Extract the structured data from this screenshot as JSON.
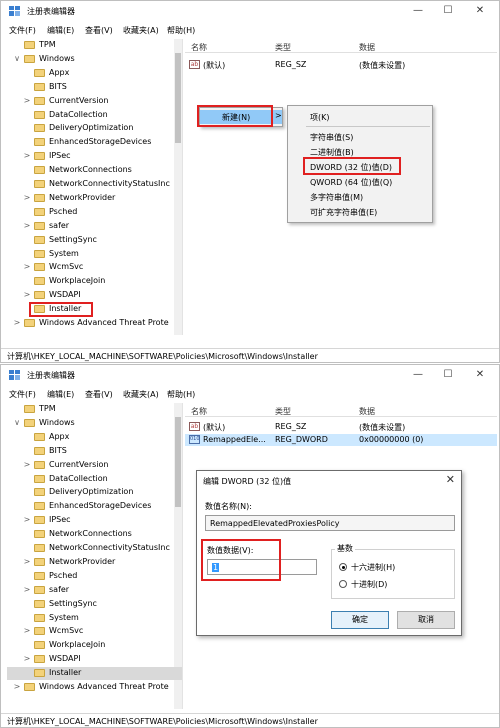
{
  "window_title": "注册表编辑器",
  "window_buttons": {
    "minimize": "—",
    "maximize": "☐",
    "close": "✕"
  },
  "menu": [
    "文件(F)",
    "编辑(E)",
    "查看(V)",
    "收藏夹(A)",
    "帮助(H)"
  ],
  "tree_items": [
    {
      "label": "TPM",
      "expander": ""
    },
    {
      "label": "Windows",
      "expander": "∨"
    },
    {
      "label": "Appx",
      "expander": ""
    },
    {
      "label": "BITS",
      "expander": ""
    },
    {
      "label": "CurrentVersion",
      "expander": ">"
    },
    {
      "label": "DataCollection",
      "expander": ""
    },
    {
      "label": "DeliveryOptimization",
      "expander": ""
    },
    {
      "label": "EnhancedStorageDevices",
      "expander": ""
    },
    {
      "label": "IPSec",
      "expander": ">"
    },
    {
      "label": "NetworkConnections",
      "expander": ""
    },
    {
      "label": "NetworkConnectivityStatusInc",
      "expander": ""
    },
    {
      "label": "NetworkProvider",
      "expander": ">"
    },
    {
      "label": "Psched",
      "expander": ""
    },
    {
      "label": "safer",
      "expander": ">"
    },
    {
      "label": "SettingSync",
      "expander": ""
    },
    {
      "label": "System",
      "expander": ""
    },
    {
      "label": "WcmSvc",
      "expander": ">"
    },
    {
      "label": "WorkplaceJoin",
      "expander": ""
    },
    {
      "label": "WSDAPI",
      "expander": ">"
    },
    {
      "label": "Installer",
      "expander": ""
    },
    {
      "label": "Windows Advanced Threat Prote",
      "expander": ">"
    }
  ],
  "columns": {
    "name": "名称",
    "type": "类型",
    "data": "数据"
  },
  "rows_top": [
    {
      "icon": "ab",
      "name": "(默认)",
      "type": "REG_SZ",
      "data": "(数值未设置)"
    }
  ],
  "rows_bottom": [
    {
      "icon": "ab",
      "name": "(默认)",
      "type": "REG_SZ",
      "data": "(数值未设置)"
    },
    {
      "icon": "010",
      "name": "RemappedEle...",
      "type": "REG_DWORD",
      "data": "0x00000000 (0)"
    }
  ],
  "context_menu": {
    "new_label": "新建(N)",
    "arrow": ">",
    "submenu": [
      "项(K)",
      "字符串值(S)",
      "二进制值(B)",
      "DWORD (32 位)值(D)",
      "QWORD (64 位)值(Q)",
      "多字符串值(M)",
      "可扩充字符串值(E)"
    ]
  },
  "status_path": "计算机\\HKEY_LOCAL_MACHINE\\SOFTWARE\\Policies\\Microsoft\\Windows\\Installer",
  "status_path_bottom": "计算机\\HKEY_LOCAL_MACHINE\\SOFTWARE\\Policies\\Microsoft\\Windows\\Installer",
  "dialog": {
    "title": "编辑 DWORD (32 位)值",
    "close": "✕",
    "name_label": "数值名称(N):",
    "name_value": "RemappedElevatedProxiesPolicy",
    "data_label": "数值数据(V):",
    "data_value": "1",
    "base_label": "基数",
    "hex_label": "十六进制(H)",
    "dec_label": "十进制(D)",
    "ok": "确定",
    "cancel": "取消"
  },
  "colors": {
    "highlight_red": "#e02020",
    "selection_blue": "#cce8ff",
    "menu_hover": "#91c9f7"
  }
}
